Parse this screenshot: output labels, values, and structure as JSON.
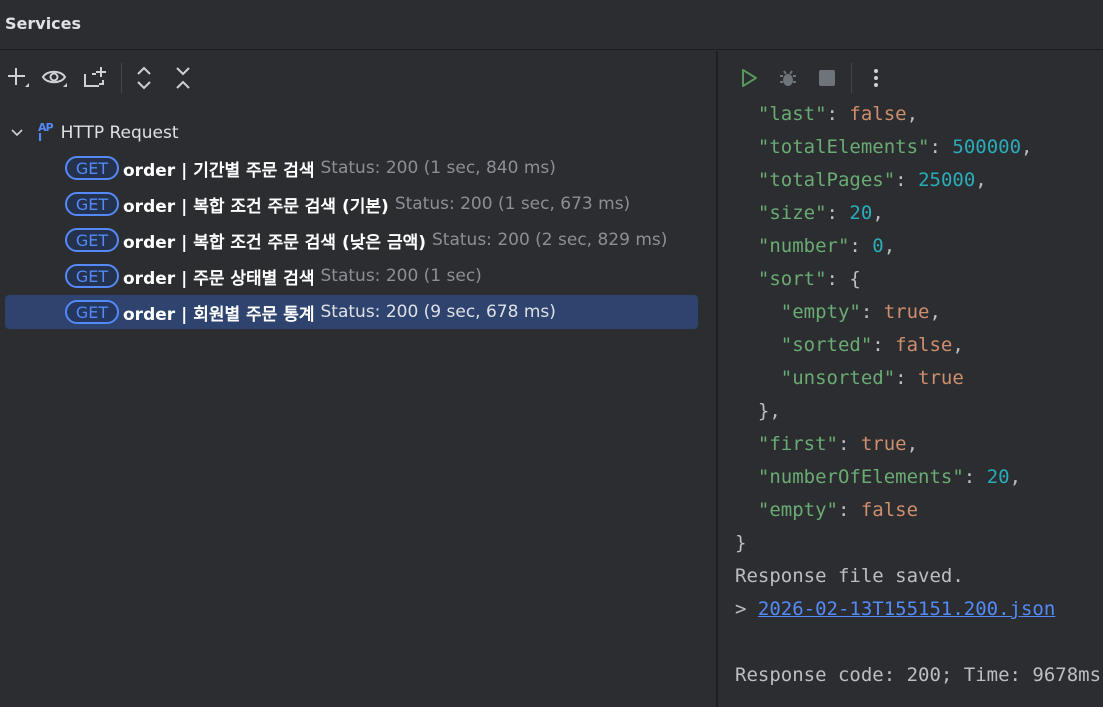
{
  "window": {
    "title": "Services"
  },
  "left_toolbar": {
    "icons": [
      "add-icon",
      "eye-icon",
      "new-group-icon",
      "expand-all-icon",
      "collapse-all-icon"
    ]
  },
  "tree": {
    "root_label": "HTTP Request",
    "requests": [
      {
        "method": "GET",
        "name": "order  |  기간별 주문 검색",
        "status": "Status: 200 (1 sec, 840 ms)"
      },
      {
        "method": "GET",
        "name": "order  |  복합 조건 주문 검색 (기본)",
        "status": "Status: 200 (1 sec, 673 ms)"
      },
      {
        "method": "GET",
        "name": "order  |  복합 조건 주문 검색 (낮은 금액)",
        "status": "Status: 200 (2 sec, 829 ms)"
      },
      {
        "method": "GET",
        "name": "order  |  주문 상태별 검색",
        "status": "Status: 200 (1 sec)"
      },
      {
        "method": "GET",
        "name": "order  |  회원별 주문 통계",
        "status": "Status: 200 (9 sec, 678 ms)"
      }
    ],
    "selected_index": 4
  },
  "right_toolbar": {
    "icons": [
      "run-icon",
      "debug-icon",
      "stop-icon",
      "more-icon"
    ],
    "accent_run": "#57965c"
  },
  "response": {
    "lines": [
      {
        "key": "\"last\"",
        "value": "false",
        "type": "bool",
        "suffix": ",",
        "indent": 1
      },
      {
        "key": "\"totalElements\"",
        "value": "500000",
        "type": "num",
        "suffix": ",",
        "indent": 1
      },
      {
        "key": "\"totalPages\"",
        "value": "25000",
        "type": "num",
        "suffix": ",",
        "indent": 1
      },
      {
        "key": "\"size\"",
        "value": "20",
        "type": "num",
        "suffix": ",",
        "indent": 1
      },
      {
        "key": "\"number\"",
        "value": "0",
        "type": "num",
        "suffix": ",",
        "indent": 1
      },
      {
        "key": "\"sort\"",
        "value": "{",
        "type": "punct",
        "suffix": "",
        "indent": 1
      },
      {
        "key": "\"empty\"",
        "value": "true",
        "type": "bool",
        "suffix": ",",
        "indent": 2
      },
      {
        "key": "\"sorted\"",
        "value": "false",
        "type": "bool",
        "suffix": ",",
        "indent": 2
      },
      {
        "key": "\"unsorted\"",
        "value": "true",
        "type": "bool",
        "suffix": "",
        "indent": 2
      },
      {
        "key": "",
        "value": "},",
        "type": "punct",
        "suffix": "",
        "indent": 1
      },
      {
        "key": "\"first\"",
        "value": "true",
        "type": "bool",
        "suffix": ",",
        "indent": 1
      },
      {
        "key": "\"numberOfElements\"",
        "value": "20",
        "type": "num",
        "suffix": ",",
        "indent": 1
      },
      {
        "key": "\"empty\"",
        "value": "false",
        "type": "bool",
        "suffix": "",
        "indent": 1
      },
      {
        "key": "",
        "value": "}",
        "type": "punct",
        "suffix": "",
        "indent": 0
      }
    ],
    "saved_text": "Response file saved.",
    "file_prefix": "> ",
    "file_link": "2026-02-13T155151.200.json",
    "footer": "Response code: 200; Time: 9678ms"
  },
  "colors": {
    "background": "#2b2d30",
    "selection": "#2e436e",
    "badge_blue": "#548af7",
    "json_key": "#6aab73",
    "json_number": "#2aacb8",
    "json_bool": "#cf8e6d"
  }
}
